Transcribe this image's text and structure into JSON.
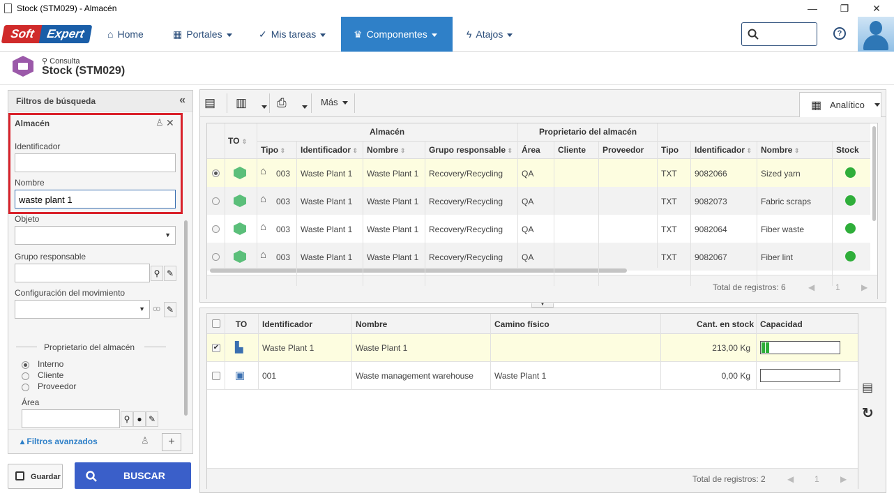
{
  "window": {
    "title": "Stock (STM029) - Almacén",
    "minimize": "—",
    "maximize": "❐",
    "close": "✕"
  },
  "nav": {
    "logo_soft": "Soft",
    "logo_expert": "Expert",
    "items": [
      {
        "label": "Home",
        "icon": "home-icon"
      },
      {
        "label": "Portales",
        "icon": "grid-icon"
      },
      {
        "label": "Mis tareas",
        "icon": "check-icon"
      },
      {
        "label": "Componentes",
        "icon": "trophy-icon"
      },
      {
        "label": "Atajos",
        "icon": "bolt-icon"
      }
    ],
    "search_placeholder": "",
    "help": "?"
  },
  "page": {
    "subtitle": "Consulta",
    "title": "Stock (STM029)"
  },
  "filters": {
    "header": "Filtros de búsqueda",
    "section": "Almacén",
    "identificador_label": "Identificador",
    "identificador_value": "",
    "nombre_label": "Nombre",
    "nombre_value": "waste plant 1",
    "objeto_label": "Objeto",
    "grupo_label": "Grupo responsable",
    "config_label": "Configuración del movimiento",
    "owner_label": "Proprietario del almacén",
    "radios": [
      "Interno",
      "Cliente",
      "Proveedor"
    ],
    "area_label": "Área",
    "advanced": "Filtros avanzados",
    "guardar": "Guardar",
    "buscar": "BUSCAR"
  },
  "toolbar": {
    "mas": "Más",
    "analitico": "Analítico"
  },
  "grid1": {
    "group_almacen": "Almacén",
    "group_owner": "Proprietario del almacén",
    "col_to": "TO",
    "columns": [
      "Tipo",
      "Identificador",
      "Nombre",
      "Grupo responsable",
      "Área",
      "Cliente",
      "Proveedor",
      "Tipo",
      "Identificador",
      "Nombre",
      "Stock"
    ],
    "rows": [
      {
        "tipo": "003",
        "ident": "Waste Plant 1",
        "nombre": "Waste Plant 1",
        "grupo": "Recovery/Recycling",
        "area": "QA",
        "cliente": "",
        "proveedor": "",
        "tipo2": "TXT",
        "ident2": "9082066",
        "nombre2": "Sized yarn"
      },
      {
        "tipo": "003",
        "ident": "Waste Plant 1",
        "nombre": "Waste Plant 1",
        "grupo": "Recovery/Recycling",
        "area": "QA",
        "cliente": "",
        "proveedor": "",
        "tipo2": "TXT",
        "ident2": "9082073",
        "nombre2": "Fabric scraps"
      },
      {
        "tipo": "003",
        "ident": "Waste Plant 1",
        "nombre": "Waste Plant 1",
        "grupo": "Recovery/Recycling",
        "area": "QA",
        "cliente": "",
        "proveedor": "",
        "tipo2": "TXT",
        "ident2": "9082064",
        "nombre2": "Fiber waste"
      },
      {
        "tipo": "003",
        "ident": "Waste Plant 1",
        "nombre": "Waste Plant 1",
        "grupo": "Recovery/Recycling",
        "area": "QA",
        "cliente": "",
        "proveedor": "",
        "tipo2": "TXT",
        "ident2": "9082067",
        "nombre2": "Fiber lint"
      }
    ],
    "total": "Total de registros: 6",
    "page": "1"
  },
  "grid2": {
    "columns": [
      "TO",
      "Identificador",
      "Nombre",
      "Camino físico",
      "Cant. en stock",
      "Capacidad"
    ],
    "rows": [
      {
        "ident": "Waste Plant 1",
        "nombre": "Waste Plant 1",
        "camino": "",
        "cant": "213,00 Kg",
        "capacidad": 0.1,
        "checked": true
      },
      {
        "ident": "001",
        "nombre": "Waste management warehouse",
        "camino": "Waste Plant 1",
        "cant": "0,00 Kg",
        "capacidad": 0,
        "checked": false
      }
    ],
    "total": "Total de registros: 2",
    "page": "1"
  },
  "colors": {
    "accent": "#2f80c8",
    "buscar": "#3a5fc9",
    "highlight": "#d9212a",
    "stock_ok": "#2fae3a",
    "selected_row": "#fdfde0"
  }
}
